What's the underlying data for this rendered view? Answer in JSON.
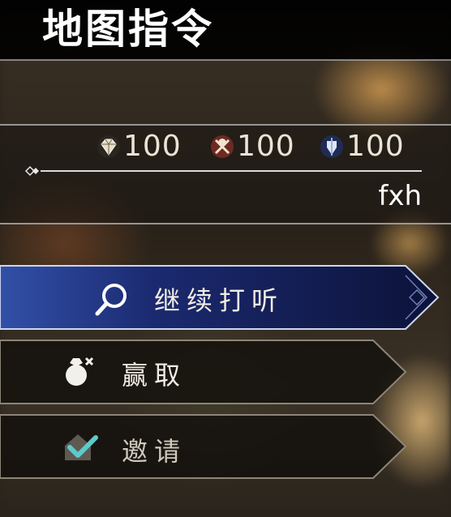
{
  "header": {
    "title": "地图指令"
  },
  "resources": [
    {
      "icon": "gem-crest-icon",
      "value": "100",
      "color": "#d8cfae"
    },
    {
      "icon": "crossed-swords-crest-icon",
      "value": "100",
      "color": "#b0503c"
    },
    {
      "icon": "winged-shield-crest-icon",
      "value": "100",
      "color": "#3f5e9a"
    }
  ],
  "player": {
    "name": "fxh"
  },
  "menu": [
    {
      "label": "继续打听",
      "icon": "magnifier-icon",
      "selected": true
    },
    {
      "label": "赢取",
      "icon": "money-bag-icon",
      "selected": false
    },
    {
      "label": "邀请",
      "icon": "house-check-icon",
      "selected": false
    }
  ],
  "colors": {
    "selected_bg": "#1c2d6e",
    "selected_border": "#8fa6e6",
    "menu_bg": "#161410",
    "accent_check": "#56c8c8"
  }
}
